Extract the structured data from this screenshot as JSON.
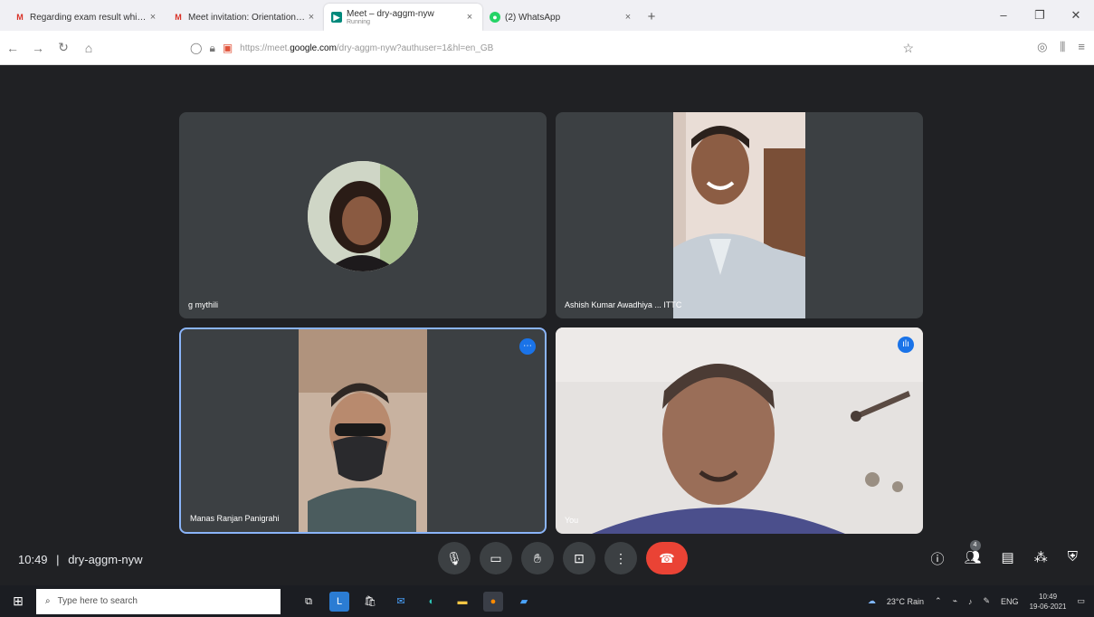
{
  "browser": {
    "tabs": [
      {
        "title": "Regarding exam result which c...",
        "favicon": "gmail-icon",
        "active": false
      },
      {
        "title": "Meet invitation: Orientation of ...",
        "favicon": "gmail-icon",
        "active": false
      },
      {
        "title": "Meet – dry-aggm-nyw",
        "subtitle": "Running",
        "favicon": "meet-icon",
        "active": true
      },
      {
        "title": "(2) WhatsApp",
        "favicon": "whatsapp-icon",
        "active": false
      }
    ],
    "url": {
      "prefix": "https://meet.",
      "domain": "google.com",
      "path": "/dry-aggm-nyw?authuser=1&hl=en_GB"
    }
  },
  "meet": {
    "participants": [
      {
        "name": "g mythili"
      },
      {
        "name": "Ashish Kumar Awadhiya ... ITTC"
      },
      {
        "name": "Manas Ranjan Panigrahi"
      },
      {
        "name": "You"
      }
    ],
    "time": "10:49",
    "separator": "|",
    "meeting_code": "dry-aggm-nyw",
    "people_count": "4"
  },
  "taskbar": {
    "search_placeholder": "Type here to search",
    "weather": "23°C Rain",
    "lang": "ENG",
    "clock_time": "10:49",
    "clock_date": "19-06-2021"
  }
}
